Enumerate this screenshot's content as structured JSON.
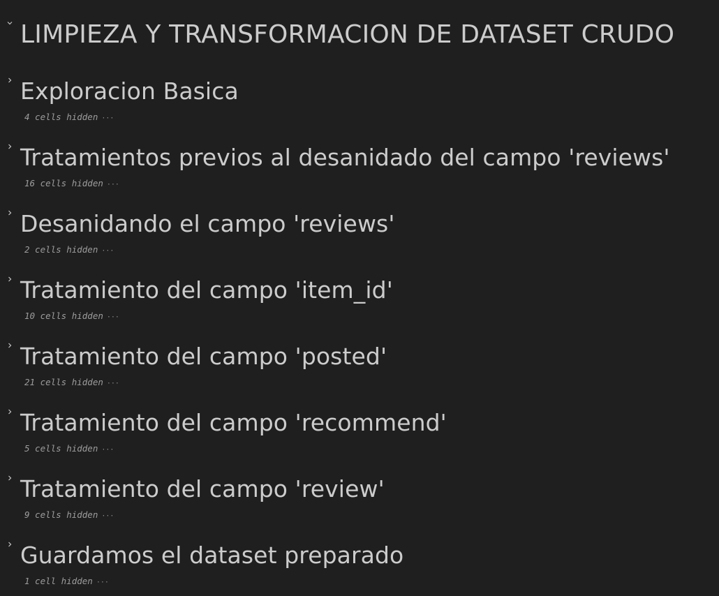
{
  "notebook": {
    "root_heading": {
      "title": "LIMPIEZA Y TRANSFORMACION DE DATASET CRUDO",
      "chevron_icon": "chevron-down-icon"
    },
    "sections": [
      {
        "title": "Exploracion Basica",
        "hidden_text": "4 cells hidden",
        "more": "···"
      },
      {
        "title": "Tratamientos previos al desanidado del campo 'reviews'",
        "hidden_text": "16 cells hidden",
        "more": "···"
      },
      {
        "title": "Desanidando el campo 'reviews'",
        "hidden_text": "2 cells hidden",
        "more": "···"
      },
      {
        "title": "Tratamiento del campo 'item_id'",
        "hidden_text": "10 cells hidden",
        "more": "···"
      },
      {
        "title": "Tratamiento del campo 'posted'",
        "hidden_text": "21 cells hidden",
        "more": "···"
      },
      {
        "title": "Tratamiento del campo 'recommend'",
        "hidden_text": "5 cells hidden",
        "more": "···"
      },
      {
        "title": "Tratamiento del campo 'review'",
        "hidden_text": "9 cells hidden",
        "more": "···"
      },
      {
        "title": "Guardamos el dataset preparado",
        "hidden_text": "1 cell hidden",
        "more": "···"
      }
    ],
    "section_chevron_icon": "chevron-right-icon"
  },
  "colors": {
    "background": "#1f1f1f",
    "heading_text": "#cccccc",
    "muted_text": "#9d9d9d"
  }
}
